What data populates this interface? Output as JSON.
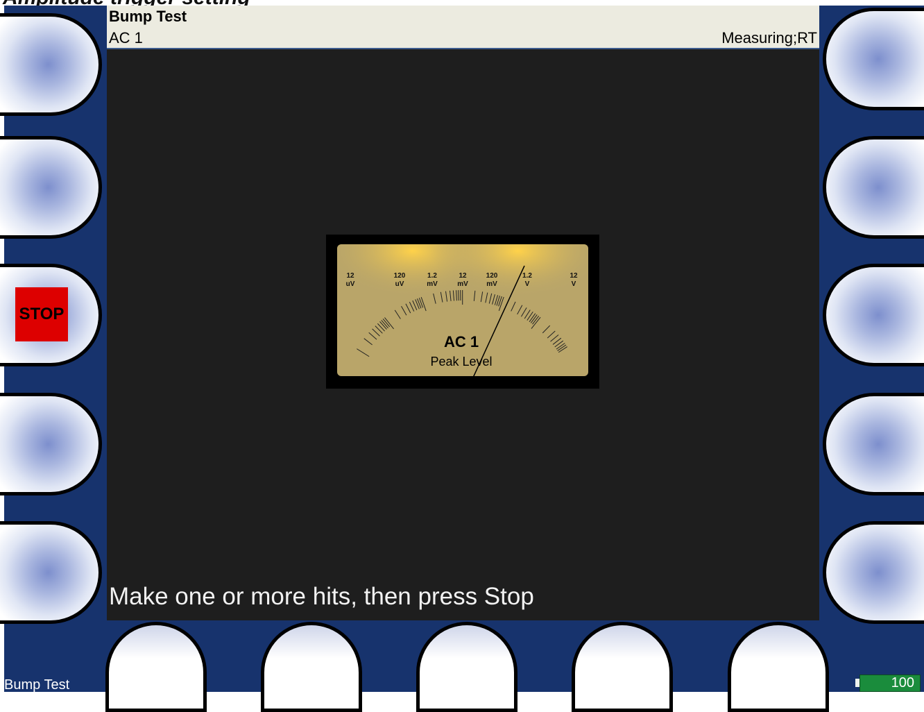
{
  "page": {
    "caption": "Amplitude trigger setting"
  },
  "header": {
    "title": "Bump Test",
    "channel": "AC 1",
    "status": "Measuring;RT"
  },
  "meter": {
    "scale_labels": [
      {
        "value": "12",
        "unit": "uV"
      },
      {
        "value": "120",
        "unit": "uV"
      },
      {
        "value": "1.2",
        "unit": "mV"
      },
      {
        "value": "12",
        "unit": "mV"
      },
      {
        "value": "120",
        "unit": "mV"
      },
      {
        "value": "1.2",
        "unit": "V"
      },
      {
        "value": "12",
        "unit": "V"
      }
    ],
    "channel_label": "AC 1",
    "mode_label": "Peak Level",
    "needle_reading": "1.2 V"
  },
  "prompt": "Make one or more hits, then press Stop",
  "softkeys": {
    "stop_label": "STOP"
  },
  "footer": {
    "mode_label": "Bump Test",
    "battery": "100"
  },
  "colors": {
    "frame": "#17336d",
    "screen": "#1e1e1e",
    "header": "#ecebe0",
    "stop": "#dd0000",
    "battery": "#1a8c3c",
    "meter_face": "#b9a569"
  }
}
